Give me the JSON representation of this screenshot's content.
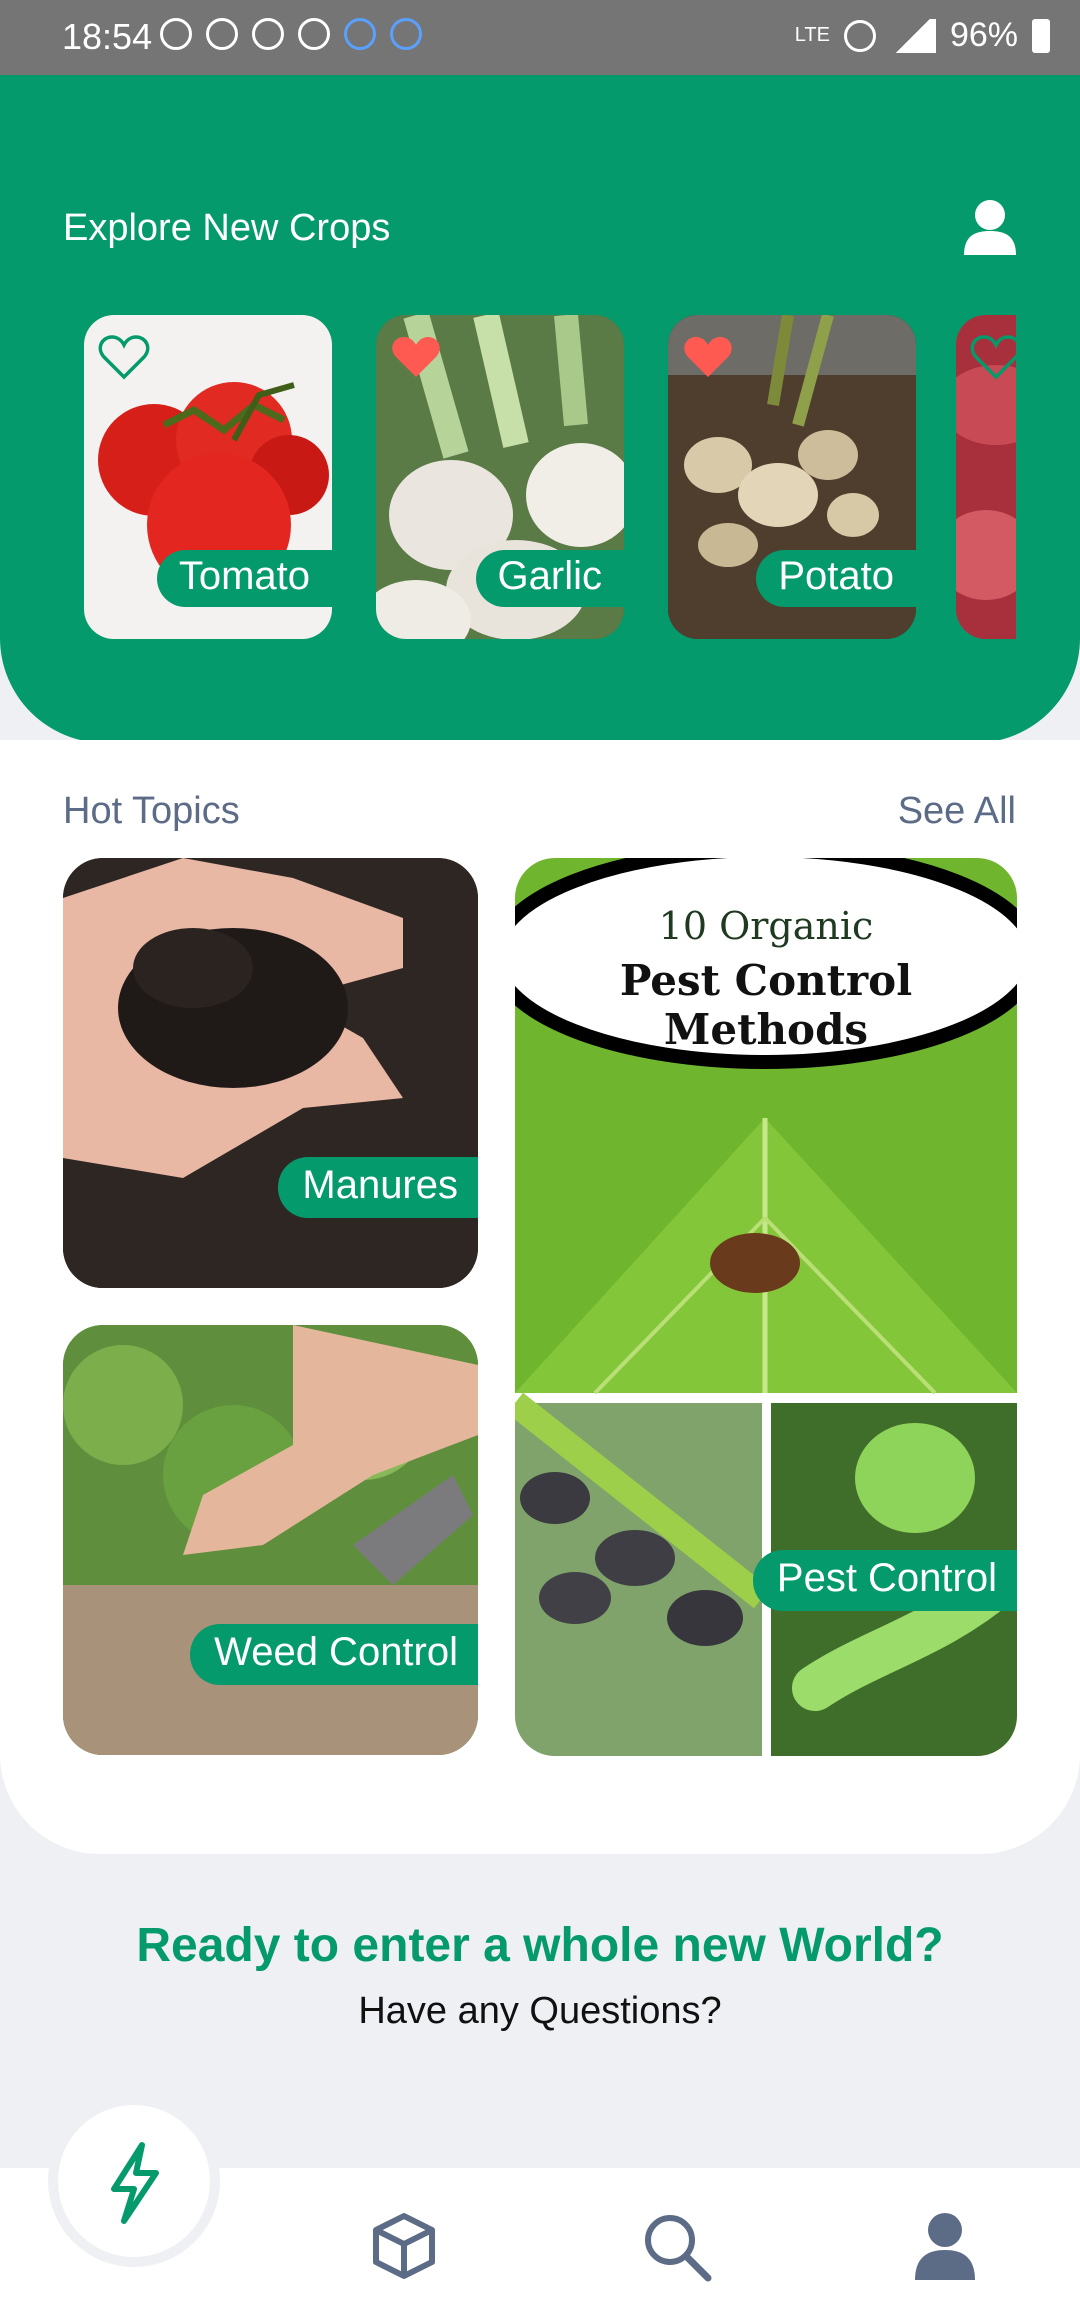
{
  "status_bar": {
    "time": "18:54",
    "battery": "96%",
    "network": "LTE"
  },
  "header": {
    "title": "Explore New Crops",
    "profile_icon": "user-icon"
  },
  "crops": [
    {
      "label": "Tomato",
      "favorite": false
    },
    {
      "label": "Garlic",
      "favorite": true
    },
    {
      "label": "Potato",
      "favorite": true
    },
    {
      "label": "",
      "favorite": false
    }
  ],
  "hot_topics": {
    "title": "Hot Topics",
    "see_all": "See All",
    "items": [
      {
        "label": "Manures"
      },
      {
        "label": "Weed Control"
      },
      {
        "label": "Pest Control",
        "poster_line1": "10 Organic",
        "poster_line2": "Pest Control Methods"
      }
    ]
  },
  "cta": {
    "title": "Ready to enter a whole new World?",
    "subtitle": "Have any Questions?"
  },
  "bottom_nav": {
    "items": [
      "flash-icon",
      "cube-icon",
      "search-icon",
      "user-icon"
    ]
  },
  "colors": {
    "accent": "#049a6c",
    "heart": "#ff5a52",
    "nav_icon": "#5c6b86"
  }
}
